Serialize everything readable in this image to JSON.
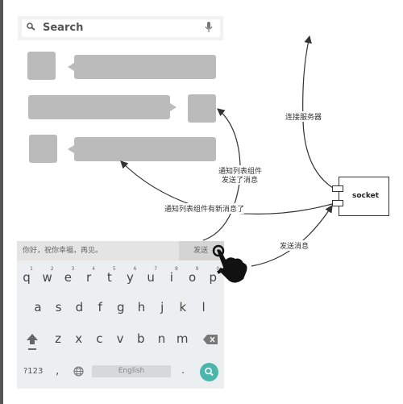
{
  "search": {
    "placeholder": "Search",
    "icons": [
      "search-icon",
      "microphone-icon"
    ]
  },
  "keyboard": {
    "input_text": "你好，祝你幸福，再见。",
    "send_label": "发送",
    "row1": [
      "q",
      "w",
      "e",
      "r",
      "t",
      "y",
      "u",
      "i",
      "o",
      "p"
    ],
    "row1_hints": [
      "1",
      "2",
      "3",
      "4",
      "5",
      "6",
      "7",
      "8",
      "9",
      "0"
    ],
    "row2": [
      "a",
      "s",
      "d",
      "f",
      "g",
      "h",
      "j",
      "k",
      "l"
    ],
    "row3": [
      "z",
      "x",
      "c",
      "v",
      "b",
      "n",
      "m"
    ],
    "symbols_label": "?123",
    "comma": ",",
    "space_label": "English",
    "period": ".",
    "accent_color": "#4db6ac"
  },
  "diagram": {
    "socket_label": "socket",
    "edge_connect": "连接服务器",
    "edge_notify_sent_line1": "通知列表组件",
    "edge_notify_sent_line2": "发送了消息",
    "edge_notify_new": "通知列表组件有新消息了",
    "edge_send": "发送消息"
  }
}
